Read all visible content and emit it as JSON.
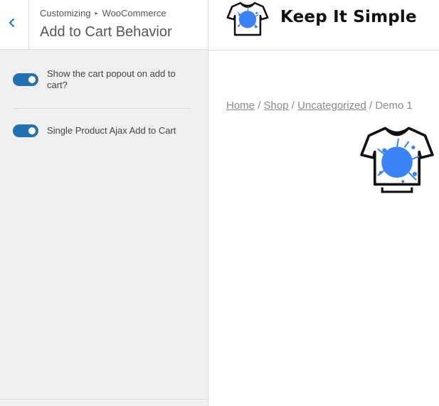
{
  "customizer": {
    "breadcrumb_root": "Customizing",
    "breadcrumb_separator": "▸",
    "breadcrumb_panel": "WooCommerce",
    "section_title": "Add to Cart Behavior",
    "back_icon": "chevron-left-icon",
    "controls": [
      {
        "label": "Show the cart popout on add to cart?",
        "enabled": true
      },
      {
        "label": "Single Product Ajax Add to Cart",
        "enabled": true
      }
    ]
  },
  "preview": {
    "site_title": "Keep It Simple",
    "logo_icon": "tshirt-splash-logo",
    "breadcrumbs": {
      "home": "Home",
      "sep1": "/",
      "shop": "Shop",
      "sep2": "/",
      "category": "Uncategorized",
      "sep3": "/",
      "current": "Demo 1"
    },
    "product_image_icon": "tshirt-splash-image"
  },
  "colors": {
    "toggle_on": "#2271b1",
    "splash_blue": "#3b82f6",
    "sidebar_bg": "#f0f0f1"
  }
}
